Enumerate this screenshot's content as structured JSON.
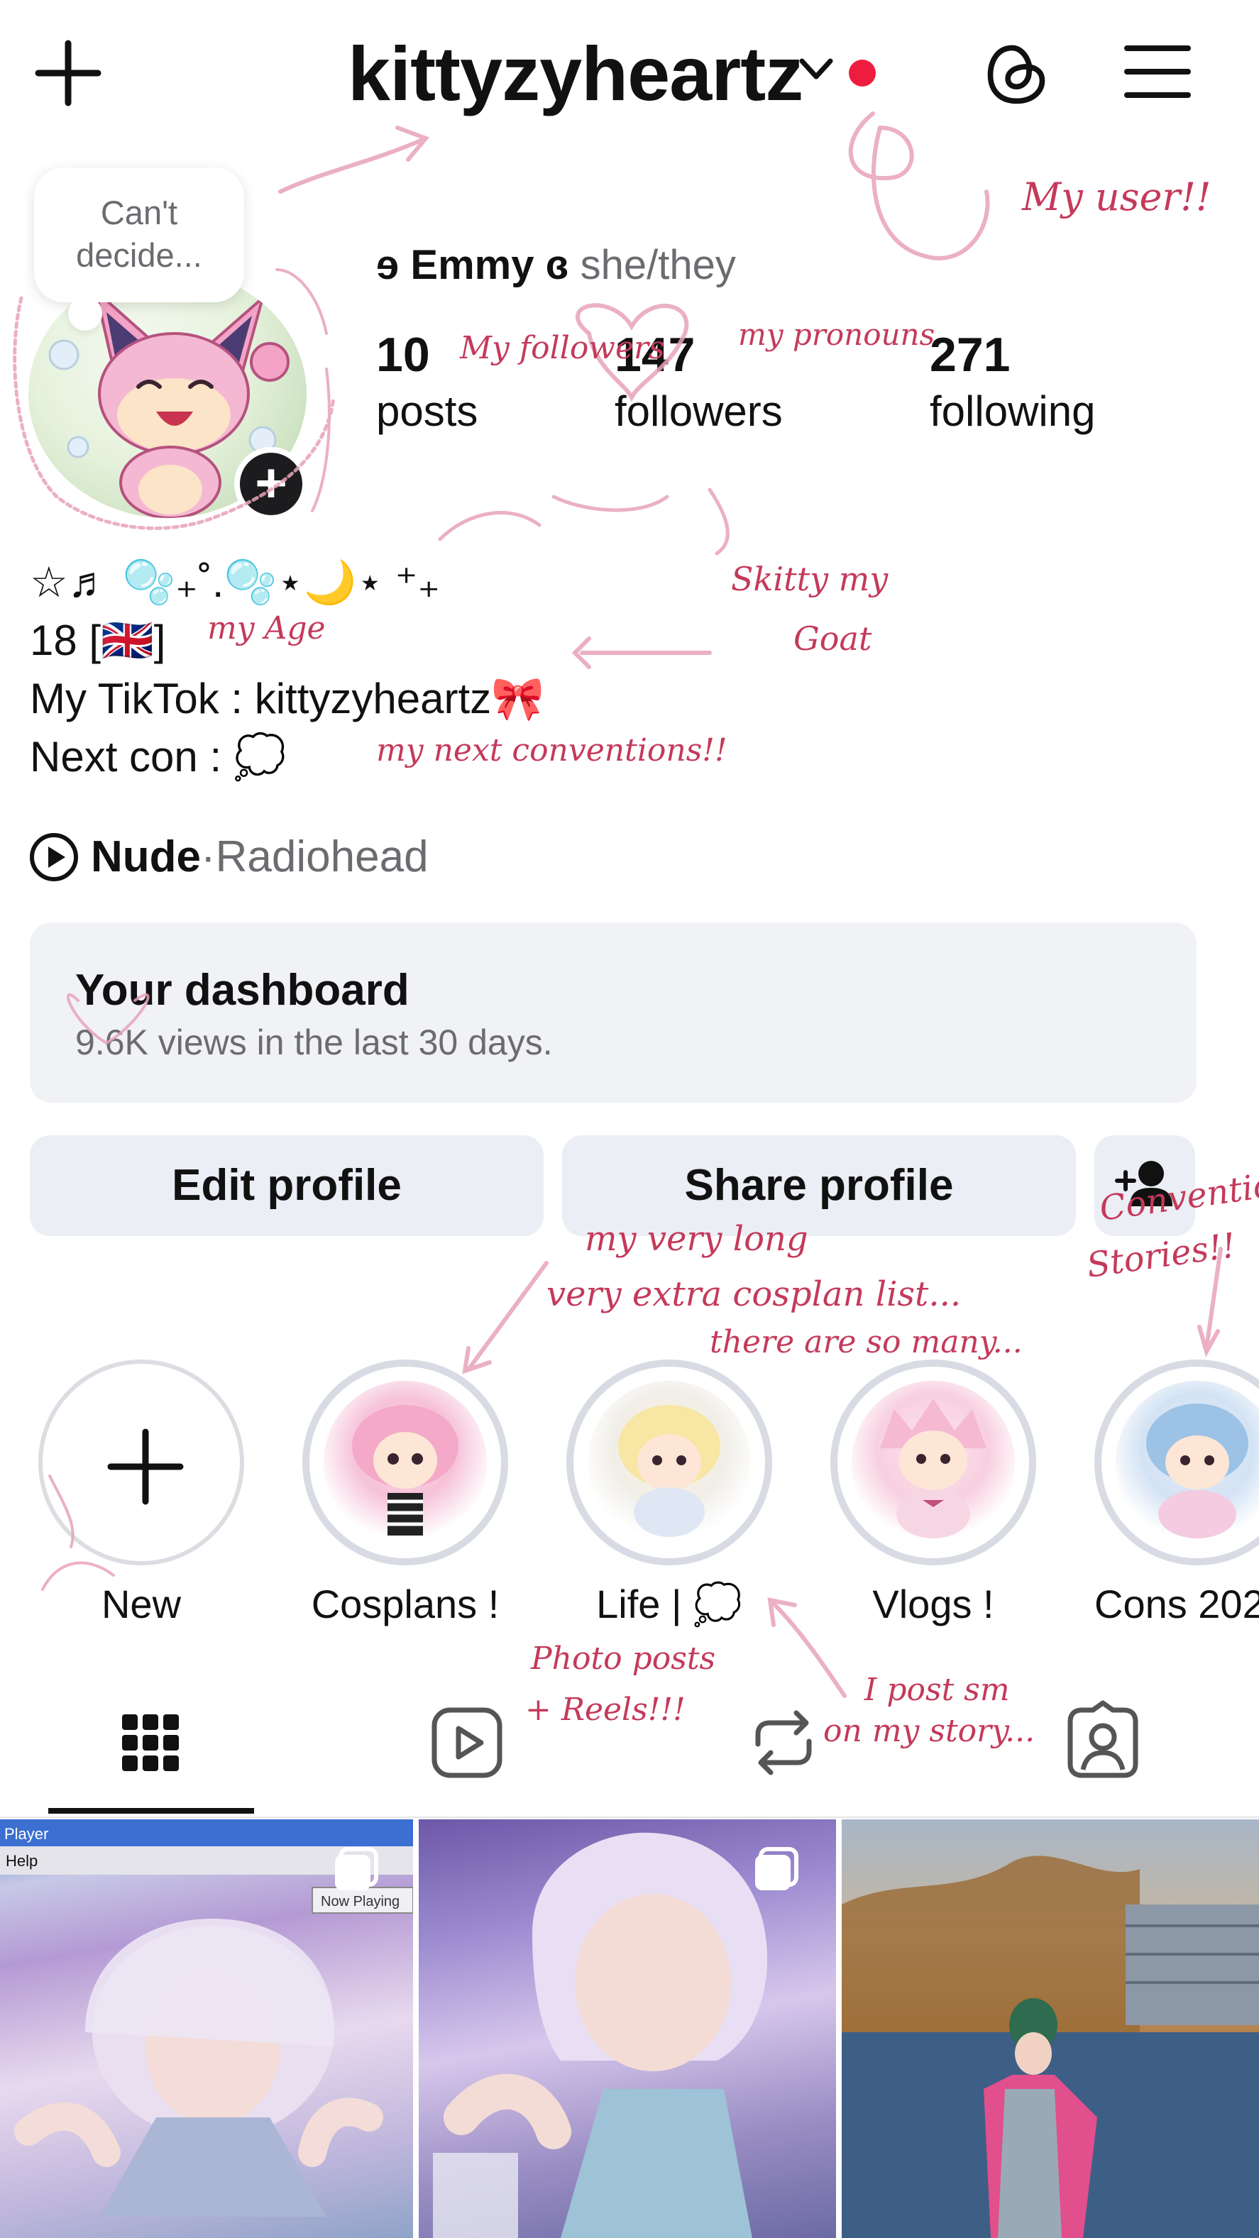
{
  "header": {
    "username": "kittyzyheartz",
    "colors": {
      "notification_dot": "#ee1d3f"
    }
  },
  "profile": {
    "note": "Can't decide...",
    "note_line1": "Can't",
    "note_line2": "decide...",
    "name_prefix": "ɘ",
    "name": "Emmy",
    "name_suffix": "ɞ",
    "pronouns": "she/they",
    "posts_count": "10",
    "posts_label": "posts",
    "followers_count": "147",
    "followers_label": "followers",
    "following_count": "271",
    "following_label": "following"
  },
  "bio": {
    "line1": "☆♬ 🫧₊˚.🫧⋆🌙⋆ ⁺₊",
    "line2": "18 [🇬🇧]",
    "line3": "My TikTok : kittyzyheartz🎀",
    "line4": "Next con : 💭"
  },
  "music": {
    "song": "Nude",
    "separator": " · ",
    "artist": "Radiohead"
  },
  "dashboard": {
    "title": "Your dashboard",
    "subtitle": "9.6K views in the last 30 days."
  },
  "buttons": {
    "edit": "Edit profile",
    "share": "Share profile"
  },
  "highlights": [
    {
      "label": "New",
      "color": "#ffffff"
    },
    {
      "label": "Cosplans !",
      "color": "#f6d3e4"
    },
    {
      "label": "Life | 💭",
      "color": "#f7f1d8"
    },
    {
      "label": "Vlogs !",
      "color": "#fadbe6"
    },
    {
      "label": "Cons 202",
      "color": "#dbe8f5"
    }
  ],
  "tabs": [
    {
      "icon": "grid-icon",
      "active": true
    },
    {
      "icon": "reels-icon",
      "active": false
    },
    {
      "icon": "reposts-icon",
      "active": false
    },
    {
      "icon": "tagged-icon",
      "active": false
    }
  ],
  "annotations": {
    "my_user": "My user!!",
    "my_followers": "My followers",
    "my_pronouns": "my pronouns",
    "skitty": "Skitty my",
    "goat": "Goat",
    "my_age": "my Age",
    "next_cons": "my next conventions!!",
    "cosplan1": "my very long",
    "cosplan2": "very extra cosplan list...",
    "cosplan3": "there are so many...",
    "convention1": "Convention",
    "convention2": "Stories!!",
    "photo1": "Photo posts",
    "photo2": "+ Reels!!!",
    "story1": "I post sm",
    "story2": "on my story...",
    "winamp_title": "Player",
    "winamp_help": "Help",
    "winamp_now": "Now Playing"
  }
}
